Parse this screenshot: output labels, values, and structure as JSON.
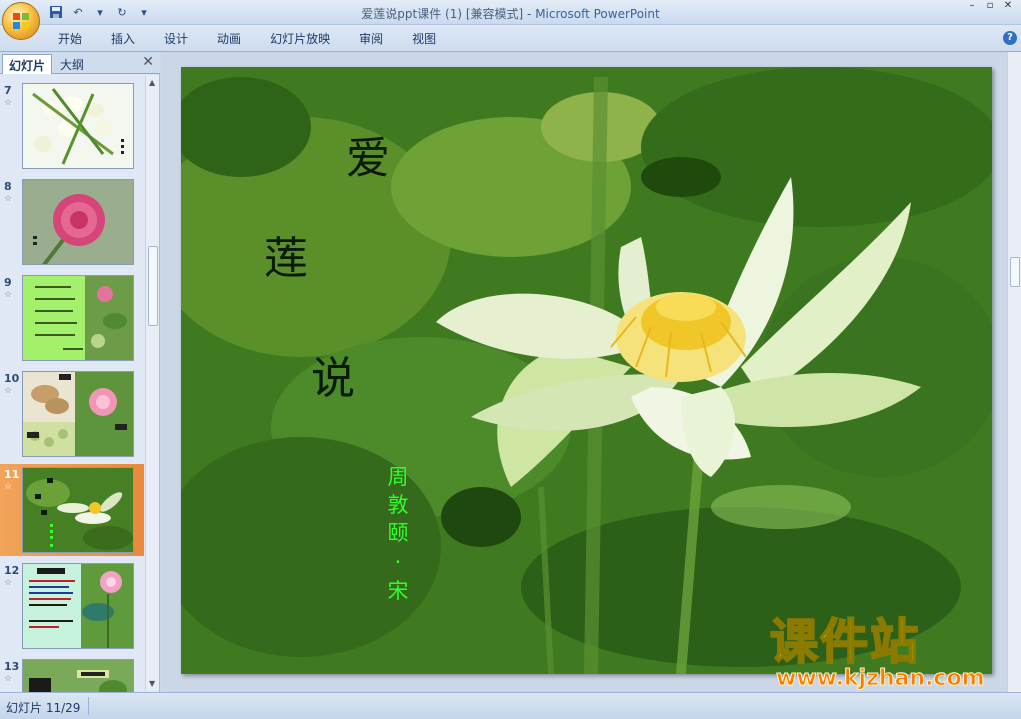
{
  "window": {
    "title_doc": "爱莲说ppt课件 (1) [兼容模式] - ",
    "title_app": "Microsoft PowerPoint"
  },
  "ribbon": {
    "tabs": [
      "开始",
      "插入",
      "设计",
      "动画",
      "幻灯片放映",
      "审阅",
      "视图"
    ]
  },
  "panel": {
    "tab_slides": "幻灯片",
    "tab_outline": "大纲",
    "thumbnails": [
      {
        "num": "7"
      },
      {
        "num": "8"
      },
      {
        "num": "9"
      },
      {
        "num": "10"
      },
      {
        "num": "11",
        "selected": true
      },
      {
        "num": "12"
      },
      {
        "num": "13"
      }
    ]
  },
  "slide": {
    "title_chars": [
      "爱",
      "莲",
      "说"
    ],
    "author_chars": [
      "周",
      "敦",
      "颐",
      "·",
      "宋"
    ]
  },
  "watermark": {
    "big": "课件站",
    "url": "www.kjzhan.com"
  },
  "status": {
    "slide_counter": "幻灯片 11/29"
  },
  "colors": {
    "slide_bg": "#3f7a20",
    "author_text": "#30ff2c",
    "selected_thumb": "#e98a3c"
  }
}
